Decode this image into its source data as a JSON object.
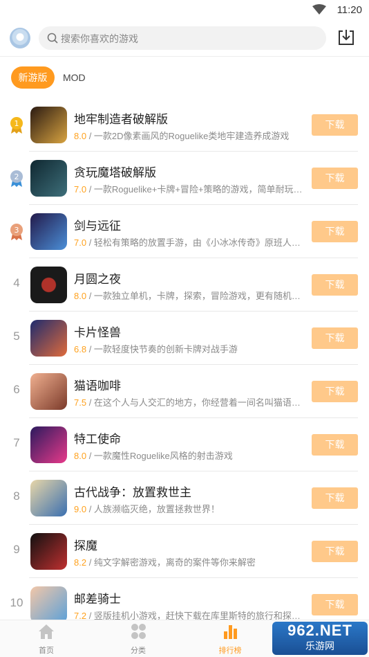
{
  "status_bar": {
    "time": "11:20"
  },
  "search": {
    "placeholder": "搜索你喜欢的游戏"
  },
  "tabs": [
    {
      "label": "新游版",
      "active": true
    },
    {
      "label": "MOD",
      "active": false
    }
  ],
  "download_label": "下载",
  "games": [
    {
      "rank": "1",
      "name": "地牢制造者破解版",
      "score": "8.0",
      "desc": "一款2D像素画风的Roguelike类地牢建造养成游戏",
      "colors": [
        "#2a1a12",
        "#d9a441"
      ]
    },
    {
      "rank": "2",
      "name": "贪玩魔塔破解版",
      "score": "7.0",
      "desc": "一款Roguelike+卡牌+冒险+策略的游戏，简单耐玩…",
      "colors": [
        "#0f2730",
        "#3e6f7a"
      ]
    },
    {
      "rank": "3",
      "name": "剑与远征",
      "score": "7.0",
      "desc": "轻松有策略的放置手游，由《小冰冰传奇》原班人…",
      "colors": [
        "#231a4a",
        "#4b8fd8"
      ]
    },
    {
      "rank": "4",
      "name": "月圆之夜",
      "score": "8.0",
      "desc": "一款独立单机，卡牌，探索，冒险游戏，更有随机…",
      "colors": [
        "#1a1a1a",
        "#b0322a"
      ]
    },
    {
      "rank": "5",
      "name": "卡片怪兽",
      "score": "6.8",
      "desc": "一款轻度快节奏的创新卡牌对战手游",
      "colors": [
        "#1e2b6e",
        "#e06b3c"
      ]
    },
    {
      "rank": "6",
      "name": "猫语咖啡",
      "score": "7.5",
      "desc": "在这个人与人交汇的地方，你经营着一间名叫猫语…",
      "colors": [
        "#f0b090",
        "#7b3a2a"
      ]
    },
    {
      "rank": "7",
      "name": "特工使命",
      "score": "8.0",
      "desc": "一款魔性Roguelike风格的射击游戏",
      "colors": [
        "#2b1a5e",
        "#e83a8a"
      ]
    },
    {
      "rank": "8",
      "name": "古代战争：放置救世主",
      "score": "9.0",
      "desc": "人族濒临灭绝，放置拯救世界！",
      "colors": [
        "#e8d6a8",
        "#3a6fb0"
      ]
    },
    {
      "rank": "9",
      "name": "探魔",
      "score": "8.2",
      "desc": "纯文字解密游戏，离奇的案件等你来解密",
      "colors": [
        "#111111",
        "#c03030"
      ]
    },
    {
      "rank": "10",
      "name": "邮差骑士",
      "score": "7.2",
      "desc": "竖版挂机小游戏，赶快下载在库里斯特的旅行和探…",
      "colors": [
        "#f3c7a8",
        "#5aa0d8"
      ]
    }
  ],
  "bottom_nav": [
    {
      "label": "首页",
      "icon": "home-icon"
    },
    {
      "label": "分类",
      "icon": "category-icon"
    },
    {
      "label": "排行榜",
      "icon": "ranking-icon",
      "active": true
    }
  ],
  "watermark": {
    "top": "962.NET",
    "bottom": "乐游网"
  },
  "colors": {
    "accent": "#ff9a1f",
    "button": "#ffc98a",
    "gold": "#f5b81c",
    "silver": "#a9bcd6",
    "bronze": "#e9a07a"
  }
}
